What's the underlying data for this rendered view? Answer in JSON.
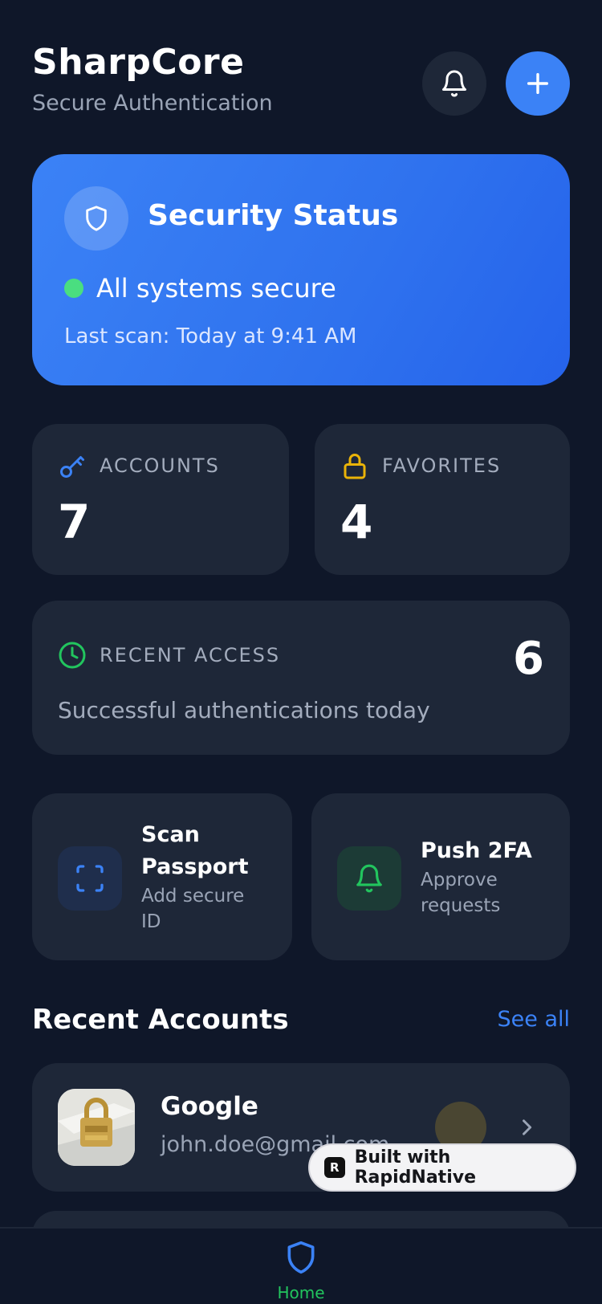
{
  "header": {
    "title": "SharpCore",
    "subtitle": "Secure Authentication",
    "icons": {
      "notifications": "bell-icon",
      "add": "plus-icon"
    }
  },
  "security": {
    "title": "Security Status",
    "status": "All systems secure",
    "last_scan": "Last scan: Today at 9:41 AM",
    "icon": "shield-icon",
    "status_color": "#4ade80"
  },
  "stats": {
    "accounts": {
      "label": "ACCOUNTS",
      "value": "7",
      "icon": "key-icon",
      "color": "#3b82f6"
    },
    "favorites": {
      "label": "FAVORITES",
      "value": "4",
      "icon": "lock-icon",
      "color": "#eab308"
    }
  },
  "recent_access": {
    "label": "RECENT ACCESS",
    "value": "6",
    "description": "Successful authentications today",
    "icon": "clock-icon",
    "color": "#22c55e"
  },
  "actions": [
    {
      "title_line1": "Scan",
      "title_line2": "Passport",
      "sub_line1": "Add secure",
      "sub_line2": "ID",
      "icon": "scan-icon",
      "color": "#3b82f6"
    },
    {
      "title": "Push 2FA",
      "sub_line1": "Approve",
      "sub_line2": "requests",
      "icon": "bell-icon",
      "color": "#22c55e"
    }
  ],
  "recent_accounts": {
    "title": "Recent Accounts",
    "see_all": "See all",
    "items": [
      {
        "name": "Google",
        "email": "john.doe@gmail.com"
      }
    ]
  },
  "badge": {
    "text": "Built with RapidNative"
  },
  "tabbar": {
    "home_label": "Home",
    "active_color": "#22c55e"
  },
  "colors": {
    "background": "#0f1729",
    "card": "#1e2738",
    "accent": "#3b82f6"
  }
}
